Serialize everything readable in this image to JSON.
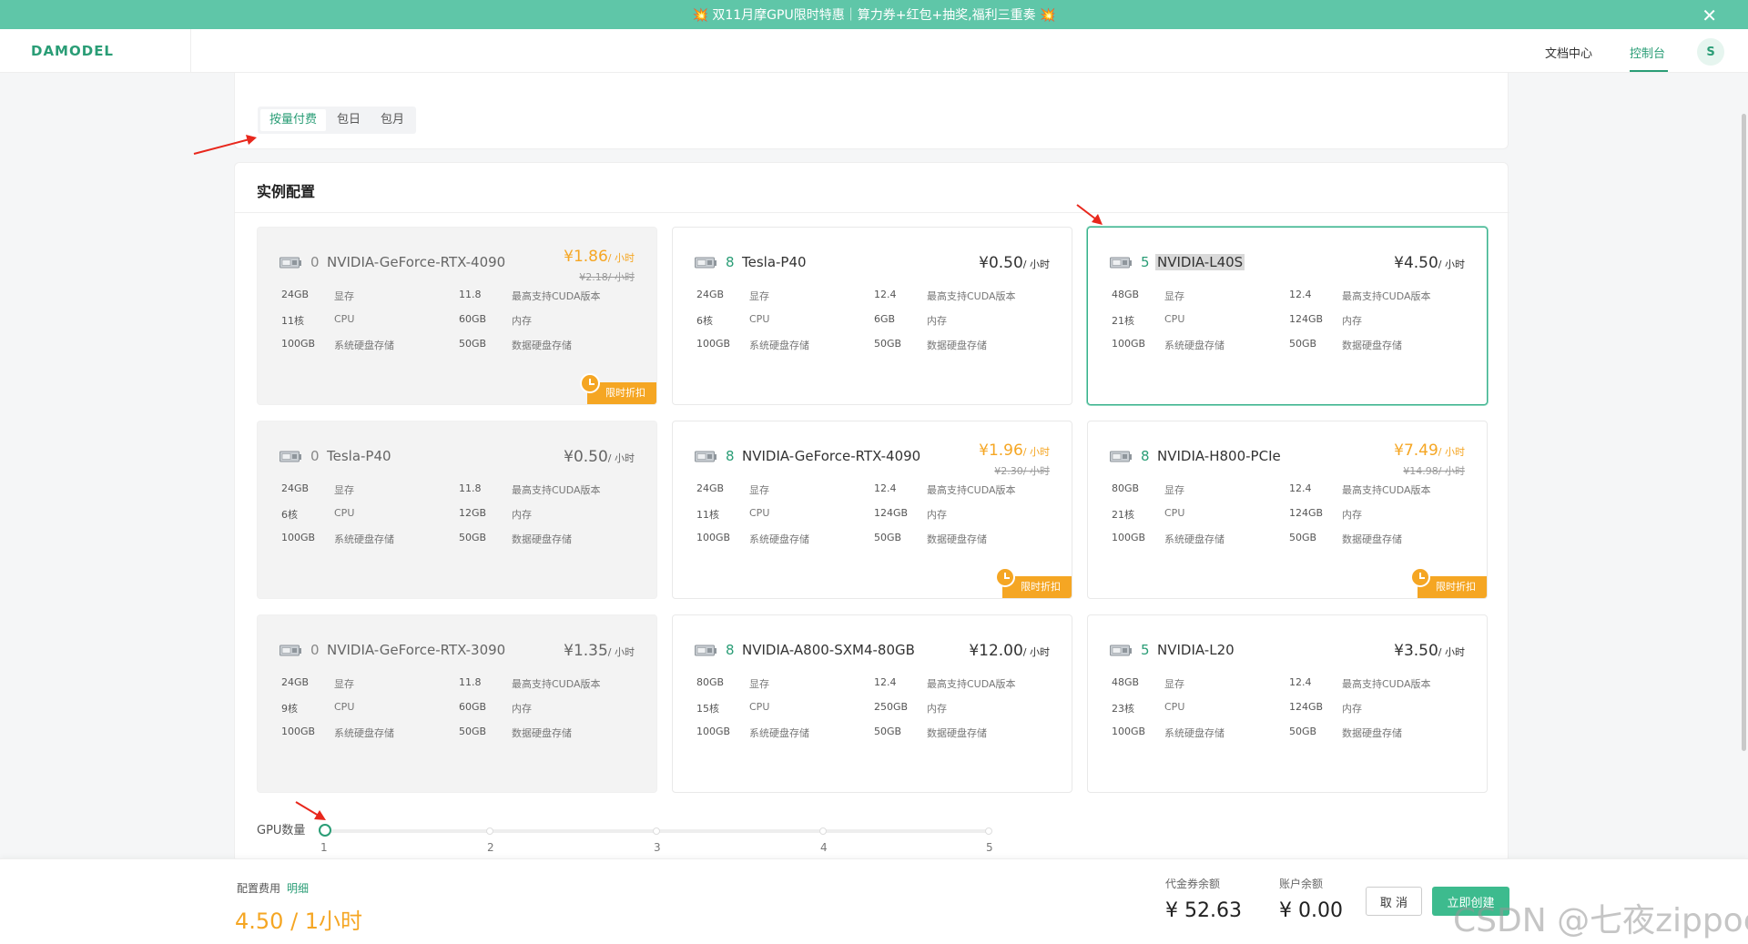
{
  "promo": {
    "text": "💥 双11月摩GPU限时特惠｜算力券+红包+抽奖,福利三重奏 💥",
    "close_icon": "close-icon"
  },
  "nav": {
    "logo": "DAMODEL",
    "docs": "文档中心",
    "console": "控制台",
    "avatar": "S"
  },
  "billing": {
    "tabs": [
      "按量付费",
      "包日",
      "包月"
    ],
    "active_tab": "按量付费"
  },
  "config": {
    "title": "实例配置"
  },
  "spec_labels": {
    "vram": "显存",
    "cuda": "最高支持CUDA版本",
    "cpu": "CPU",
    "mem": "内存",
    "sys_disk": "系统硬盘存储",
    "data_disk": "数据硬盘存储"
  },
  "price_unit": "/ 小时",
  "badge_text": "限时折扣",
  "cards": [
    {
      "count": "0",
      "name": "NVIDIA-GeForce-RTX-4090",
      "price": "¥1.86",
      "old_price": "¥2.18/ 小时",
      "vram": "24GB",
      "cuda": "11.8",
      "cpu": "11核",
      "mem": "60GB",
      "sys_disk": "100GB",
      "data_disk": "50GB",
      "disabled": true,
      "discount": true
    },
    {
      "count": "8",
      "name": "Tesla-P40",
      "price": "¥0.50",
      "old_price": "",
      "vram": "24GB",
      "cuda": "12.4",
      "cpu": "6核",
      "mem": "6GB",
      "sys_disk": "100GB",
      "data_disk": "50GB",
      "disabled": false,
      "discount": false
    },
    {
      "count": "5",
      "name": "NVIDIA-L40S",
      "price": "¥4.50",
      "old_price": "",
      "vram": "48GB",
      "cuda": "12.4",
      "cpu": "21核",
      "mem": "124GB",
      "sys_disk": "100GB",
      "data_disk": "50GB",
      "disabled": false,
      "discount": false,
      "selected": true
    },
    {
      "count": "0",
      "name": "Tesla-P40",
      "price": "¥0.50",
      "old_price": "",
      "vram": "24GB",
      "cuda": "11.8",
      "cpu": "6核",
      "mem": "12GB",
      "sys_disk": "100GB",
      "data_disk": "50GB",
      "disabled": true,
      "discount": false
    },
    {
      "count": "8",
      "name": "NVIDIA-GeForce-RTX-4090",
      "price": "¥1.96",
      "old_price": "¥2.30/ 小时",
      "vram": "24GB",
      "cuda": "12.4",
      "cpu": "11核",
      "mem": "124GB",
      "sys_disk": "100GB",
      "data_disk": "50GB",
      "disabled": false,
      "discount": true
    },
    {
      "count": "8",
      "name": "NVIDIA-H800-PCIe",
      "price": "¥7.49",
      "old_price": "¥14.98/ 小时",
      "vram": "80GB",
      "cuda": "12.4",
      "cpu": "21核",
      "mem": "124GB",
      "sys_disk": "100GB",
      "data_disk": "50GB",
      "disabled": false,
      "discount": true
    },
    {
      "count": "0",
      "name": "NVIDIA-GeForce-RTX-3090",
      "price": "¥1.35",
      "old_price": "",
      "vram": "24GB",
      "cuda": "11.8",
      "cpu": "9核",
      "mem": "60GB",
      "sys_disk": "100GB",
      "data_disk": "50GB",
      "disabled": true,
      "discount": false
    },
    {
      "count": "8",
      "name": "NVIDIA-A800-SXM4-80GB",
      "price": "¥12.00",
      "old_price": "",
      "vram": "80GB",
      "cuda": "12.4",
      "cpu": "15核",
      "mem": "250GB",
      "sys_disk": "100GB",
      "data_disk": "50GB",
      "disabled": false,
      "discount": false
    },
    {
      "count": "5",
      "name": "NVIDIA-L20",
      "price": "¥3.50",
      "old_price": "",
      "vram": "48GB",
      "cuda": "12.4",
      "cpu": "23核",
      "mem": "124GB",
      "sys_disk": "100GB",
      "data_disk": "50GB",
      "disabled": false,
      "discount": false
    }
  ],
  "gpu_count": {
    "label": "GPU数量",
    "ticks": [
      "1",
      "2",
      "3",
      "4",
      "5"
    ],
    "selected": 1
  },
  "footer": {
    "cost_label": "配置费用",
    "detail": "明细",
    "total": "4.50 / 1小时",
    "voucher_label": "代金券余额",
    "voucher_value": "¥ 52.63",
    "balance_label": "账户余额",
    "balance_value": "¥ 0.00",
    "cancel": "取 消",
    "create": "立即创建"
  },
  "watermark": "CSDN @七夜zippoe",
  "colors": {
    "brand": "#2a9d76",
    "promo_bg": "#5fc6a8",
    "discount": "#f5a623",
    "annotation_arrow": "#e8271c"
  }
}
